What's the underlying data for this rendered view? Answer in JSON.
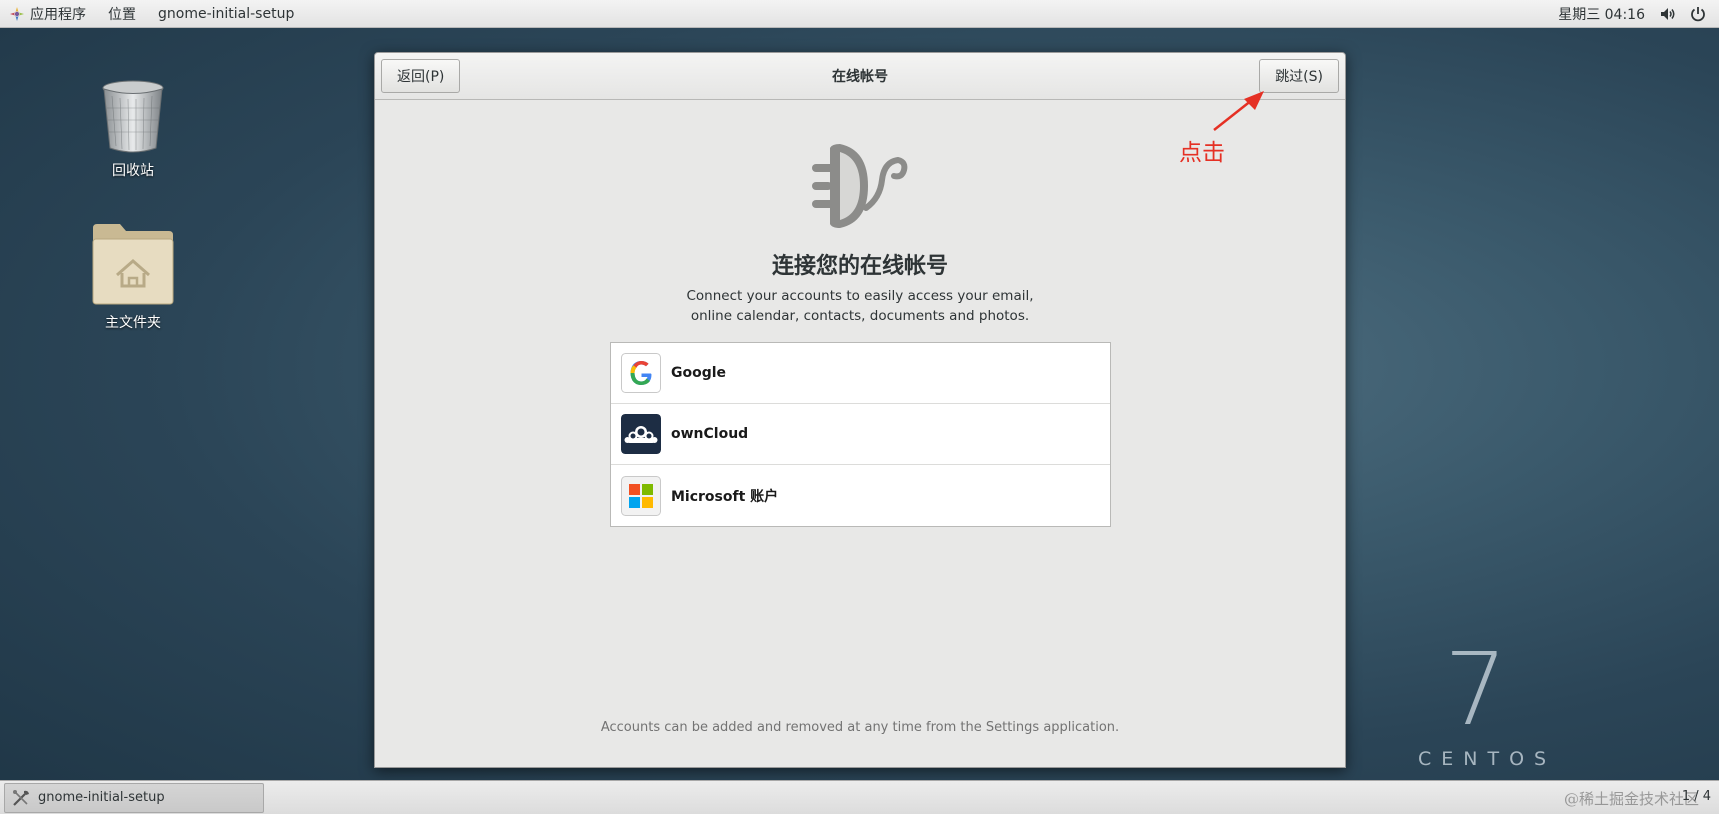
{
  "topbar": {
    "applications": "应用程序",
    "places": "位置",
    "active_app": "gnome-initial-setup",
    "clock": "星期三 04:16"
  },
  "desktop": {
    "trash_label": "回收站",
    "home_label": "主文件夹"
  },
  "dialog": {
    "title": "在线帐号",
    "back_button": "返回(P)",
    "skip_button": "跳过(S)",
    "heading": "连接您的在线帐号",
    "description_line1": "Connect your accounts to easily access your email,",
    "description_line2": "online calendar, contacts, documents and photos.",
    "accounts": [
      {
        "name": "Google",
        "icon": "google-icon"
      },
      {
        "name": "ownCloud",
        "icon": "owncloud-icon"
      },
      {
        "name": "Microsoft 账户",
        "icon": "microsoft-icon"
      }
    ],
    "footer": "Accounts can be added and removed at any time from the Settings application."
  },
  "annotation": {
    "label": "点击",
    "color": "#e53024"
  },
  "branding": {
    "version": "7",
    "name": "CENTOS"
  },
  "bottombar": {
    "task_label": "gnome-initial-setup",
    "pager": "1 / 4",
    "watermark": "@稀土掘金技术社区"
  }
}
